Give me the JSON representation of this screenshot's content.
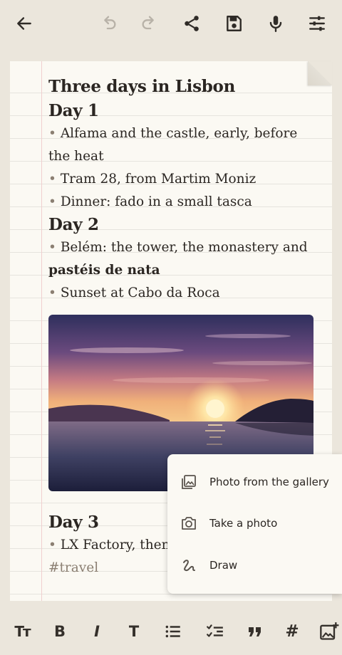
{
  "toolbar": {
    "icons": [
      "back-arrow-icon",
      "undo-icon",
      "redo-icon",
      "share-icon",
      "save-icon",
      "microphone-icon",
      "settings-sliders-icon"
    ]
  },
  "note": {
    "title": "Three days in Lisbon",
    "days": [
      {
        "heading": "Day 1",
        "items": [
          "Alfama and the castle, early, before the heat",
          "Tram 28, from Martim Moniz",
          "Dinner: fado in a small tasca"
        ]
      },
      {
        "heading": "Day 2",
        "item1_text": "Belém: the tower, the monastery and ",
        "item1_bold": "pastéis de nata",
        "item2": "Sunset at Cabo da Roca"
      },
      {
        "heading": "Day 3",
        "items": [
          "LX Factory, then"
        ]
      }
    ],
    "bullet": "•",
    "image_icon": "sunset-photo",
    "tag": "#travel"
  },
  "insert_menu": {
    "items": [
      {
        "label": "Photo from the gallery",
        "icon": "gallery-icon"
      },
      {
        "label": "Take a photo",
        "icon": "camera-icon"
      },
      {
        "label": "Draw",
        "icon": "scribble-icon"
      }
    ]
  },
  "format_bar": {
    "text_size": "Tт",
    "bold": "B",
    "italic": "I",
    "plain": "T",
    "hash": "#",
    "icons": [
      "text-size-icon",
      "bold-icon",
      "italic-icon",
      "plain-text-icon",
      "bullet-list-icon",
      "checklist-icon",
      "quote-icon",
      "hashtag-icon",
      "add-image-icon"
    ]
  },
  "colors": {
    "background": "#ebe6dc",
    "paper": "#fbf9f3",
    "text": "#2b2622",
    "muted": "#8b7f72"
  }
}
